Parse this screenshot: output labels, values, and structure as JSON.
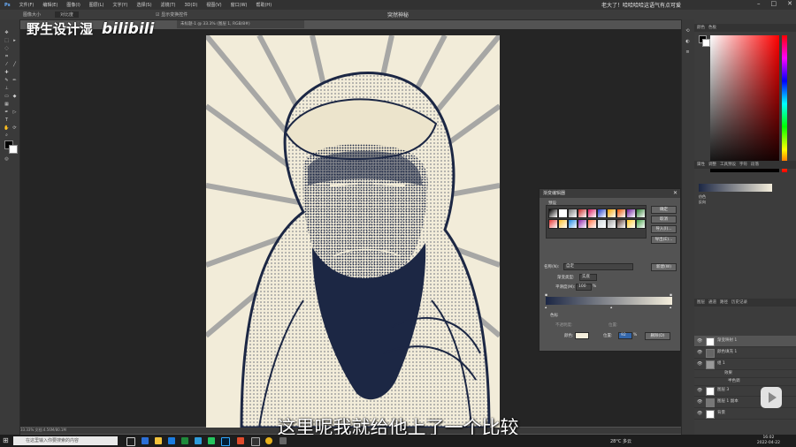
{
  "menubar": {
    "items": [
      "文件(F)",
      "编辑(E)",
      "图像(I)",
      "图层(L)",
      "文字(Y)",
      "选择(S)",
      "滤镜(T)",
      "3D(D)",
      "视图(V)",
      "窗口(W)",
      "帮助(H)"
    ],
    "notice": "老大了！哈哈哈哈这语气有点可爱"
  },
  "app": {
    "name": "突然神秘"
  },
  "options_bar": {
    "mode_label": "图像大小",
    "mode_value": "对比度",
    "toggle_label": "显示变换控件"
  },
  "document": {
    "tab": "未标题-1 @ 33.3% (图层 1, RGB/8#)"
  },
  "watermark": {
    "text": "野生设计湿",
    "logo": "bilibili"
  },
  "statusbar": {
    "text": "33.33%   文档:4.56M/80.1M"
  },
  "panels": {
    "color_tabs": [
      "颜色",
      "色板"
    ],
    "properties_tabs": [
      "属性",
      "调整",
      "工具预设",
      "字符",
      "段落"
    ],
    "properties_items": [
      "仿色",
      "反向"
    ],
    "layers_tabs": [
      "图层",
      "通道",
      "路径",
      "历史记录"
    ],
    "layers": [
      {
        "name": "渐变映射 1"
      },
      {
        "name": "颜色填充 1"
      },
      {
        "name": "组 1"
      },
      {
        "name": "效果"
      },
      {
        "name": "半色调"
      },
      {
        "name": "图层 3"
      },
      {
        "name": "图层 1 副本"
      },
      {
        "name": "背景"
      }
    ]
  },
  "dialog": {
    "title": "渐变编辑器",
    "presets_label": "预设",
    "buttons": [
      "确定",
      "取消",
      "导入(I)...",
      "导出(E)..."
    ],
    "name_label": "名称(N):",
    "name_value": "自定",
    "new_button": "新建(W)",
    "type_label": "渐变类型:",
    "type_value": "实底",
    "smooth_label": "平滑度(M):",
    "smooth_value": "100",
    "smooth_unit": "%",
    "stops_label": "色标",
    "opacity_label": "不透明度:",
    "location_label": "位置:",
    "color_label": "颜色:",
    "location_value": "92",
    "location_unit": "%",
    "delete_button": "删除(D)",
    "preset_colors": [
      "#000000",
      "#ffffff",
      "#7a7a7a",
      "#c62828",
      "#d81b60",
      "#1e3cc8",
      "#f4a300",
      "#e65100",
      "#6a1b9a",
      "#2e7d32",
      "#e53935",
      "#fbc02d",
      "#1e88e5",
      "#8e24aa",
      "#ff7043",
      "#cfd8dc",
      "#a0a0a0",
      "#5d4037",
      "#ffca28",
      "#43a047"
    ]
  },
  "subtitle": "这里呢我就给他上了一个比较",
  "taskbar": {
    "search_placeholder": "在这里输入你要搜索的内容",
    "weather": "28°C 多云",
    "time": "16:02",
    "date": "2022-04-22"
  }
}
